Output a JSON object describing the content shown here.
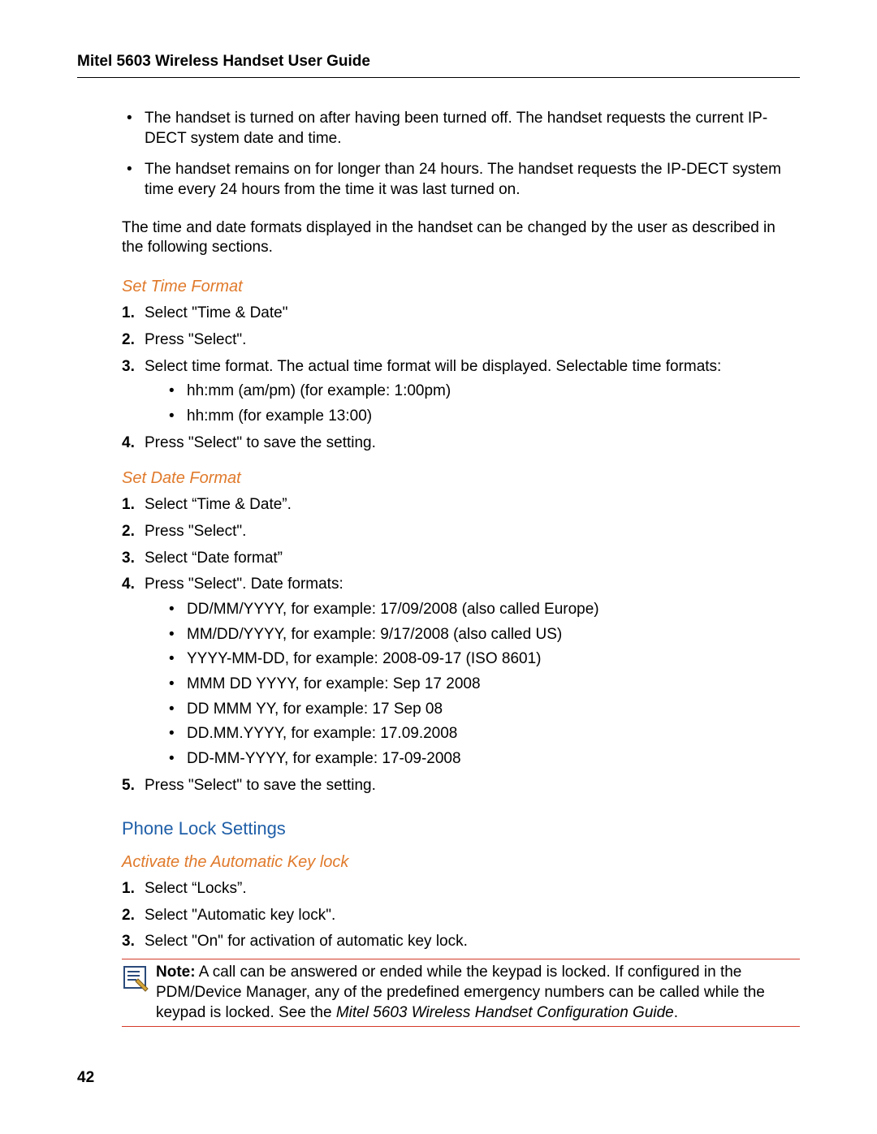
{
  "header": {
    "title": "Mitel 5603 Wireless Handset User Guide"
  },
  "intro": {
    "bullets": [
      "The handset is turned on after having been turned off. The handset requests the current IP-DECT system date and time.",
      "The handset remains on for longer than 24 hours. The handset requests the IP-DECT system time every 24 hours from the time it was last turned on."
    ],
    "paragraph": "The time and date formats displayed in the handset can be changed by the user as described in the following sections."
  },
  "time_format": {
    "heading": "Set Time Format",
    "steps": [
      "Select \"Time & Date\"",
      "Press \"Select\".",
      "Select time format. The actual time format will be displayed. Selectable time formats:",
      "Press \"Select\" to save the setting."
    ],
    "formats": [
      "hh:mm (am/pm) (for example: 1:00pm)",
      "hh:mm  (for example 13:00)"
    ]
  },
  "date_format": {
    "heading": "Set Date Format",
    "steps": [
      "Select “Time & Date”.",
      "Press \"Select\".",
      "Select “Date format”",
      "Press \"Select\". Date formats:",
      "Press \"Select\" to save the setting."
    ],
    "formats": [
      "DD/MM/YYYY, for example: 17/09/2008 (also called Europe)",
      "MM/DD/YYYY, for example: 9/17/2008 (also called US)",
      "YYYY-MM-DD, for example: 2008-09-17 (ISO 8601)",
      "MMM DD YYYY, for example: Sep 17 2008",
      "DD MMM YY, for example: 17 Sep 08",
      "DD.MM.YYYY, for example: 17.09.2008",
      "DD-MM-YYYY, for example: 17-09-2008"
    ]
  },
  "phone_lock": {
    "heading": "Phone Lock Settings",
    "sub_heading": "Activate the Automatic Key lock",
    "steps": [
      "Select “Locks”.",
      "Select \"Automatic key lock\".",
      "Select \"On\" for activation of automatic key lock."
    ],
    "note_lead": "Note:",
    "note_body": " A call can be answered or ended while the keypad is locked. If configured in the PDM/Device Manager, any of the predefined emergency numbers can be called while the keypad is locked. See the ",
    "note_ref": "Mitel 5603 Wireless Handset Configuration Guide",
    "note_tail": "."
  },
  "page_number": "42"
}
